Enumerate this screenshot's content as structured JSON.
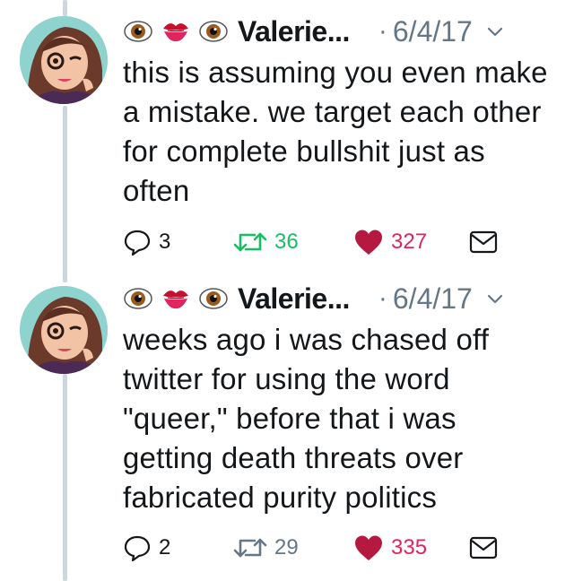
{
  "colors": {
    "retweet_active": "#17bf63",
    "like": "#b5193f",
    "like_count": "#e0245e",
    "muted": "#657786",
    "thread_line": "#ccd6dd"
  },
  "tweets": [
    {
      "name": "Valerie...",
      "emojis": [
        "eye-icon",
        "kiss-mark-icon",
        "eye-icon"
      ],
      "dot": "·",
      "date": "6/4/17",
      "text": "this is assuming you even make a mistake. we target each other for complete bullshit just as often",
      "replies": "3",
      "retweets": "36",
      "retweeted": true,
      "likes": "327",
      "liked": true
    },
    {
      "name": "Valerie...",
      "emojis": [
        "eye-icon",
        "kiss-mark-icon",
        "eye-icon"
      ],
      "dot": "·",
      "date": "6/4/17",
      "text": "weeks ago i was chased off twitter for using the word \"queer,\" before that i was getting death threats over fabricated purity politics",
      "replies": "2",
      "retweets": "29",
      "retweeted": false,
      "likes": "335",
      "liked": true
    }
  ]
}
